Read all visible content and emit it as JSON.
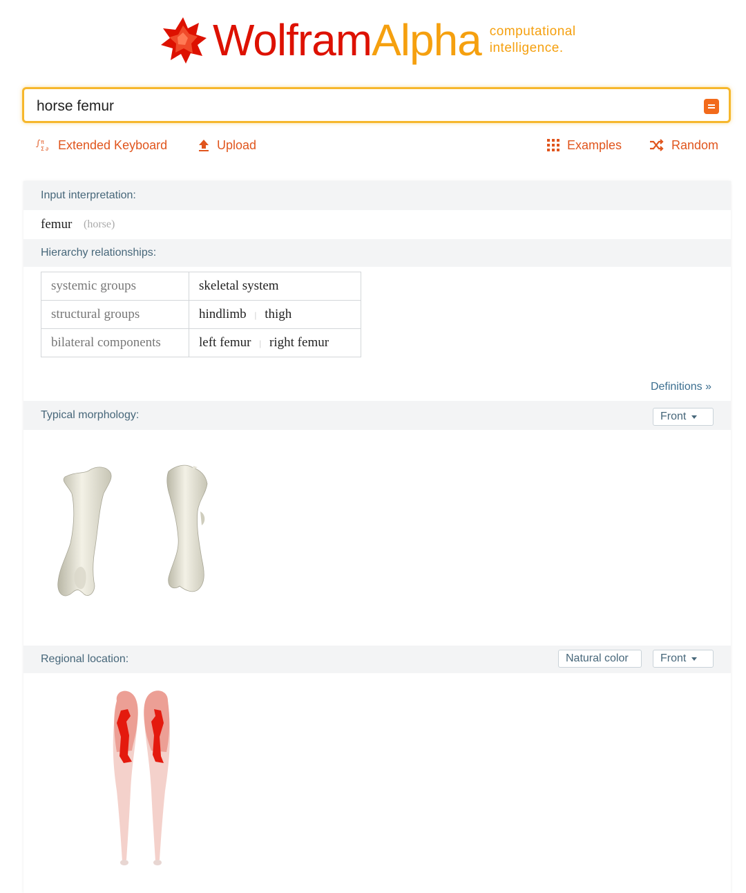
{
  "brand": {
    "name_part1": "Wolfram",
    "name_part2": "Alpha",
    "tagline_line1": "computational",
    "tagline_line2": "intelligence."
  },
  "search": {
    "query": "horse femur"
  },
  "toolbar": {
    "extended_keyboard": "Extended Keyboard",
    "upload": "Upload",
    "examples": "Examples",
    "random": "Random"
  },
  "pods": {
    "input_interpretation": {
      "title": "Input interpretation:",
      "term": "femur",
      "qualifier": "(horse)"
    },
    "hierarchy": {
      "title": "Hierarchy relationships:",
      "rows": [
        {
          "key": "systemic groups",
          "values": [
            "skeletal system"
          ]
        },
        {
          "key": "structural groups",
          "values": [
            "hindlimb",
            "thigh"
          ]
        },
        {
          "key": "bilateral components",
          "values": [
            "left femur",
            "right femur"
          ]
        }
      ],
      "definitions_link": "Definitions »"
    },
    "morphology": {
      "title": "Typical morphology:",
      "view_option": "Front"
    },
    "regional": {
      "title": "Regional location:",
      "color_option": "Natural color",
      "view_option": "Front"
    }
  },
  "colors": {
    "brand_red": "#dd1100",
    "brand_orange": "#f5a00f",
    "search_border": "#f6b72c",
    "link_orange": "#e0551d",
    "pod_title": "#47677a"
  }
}
